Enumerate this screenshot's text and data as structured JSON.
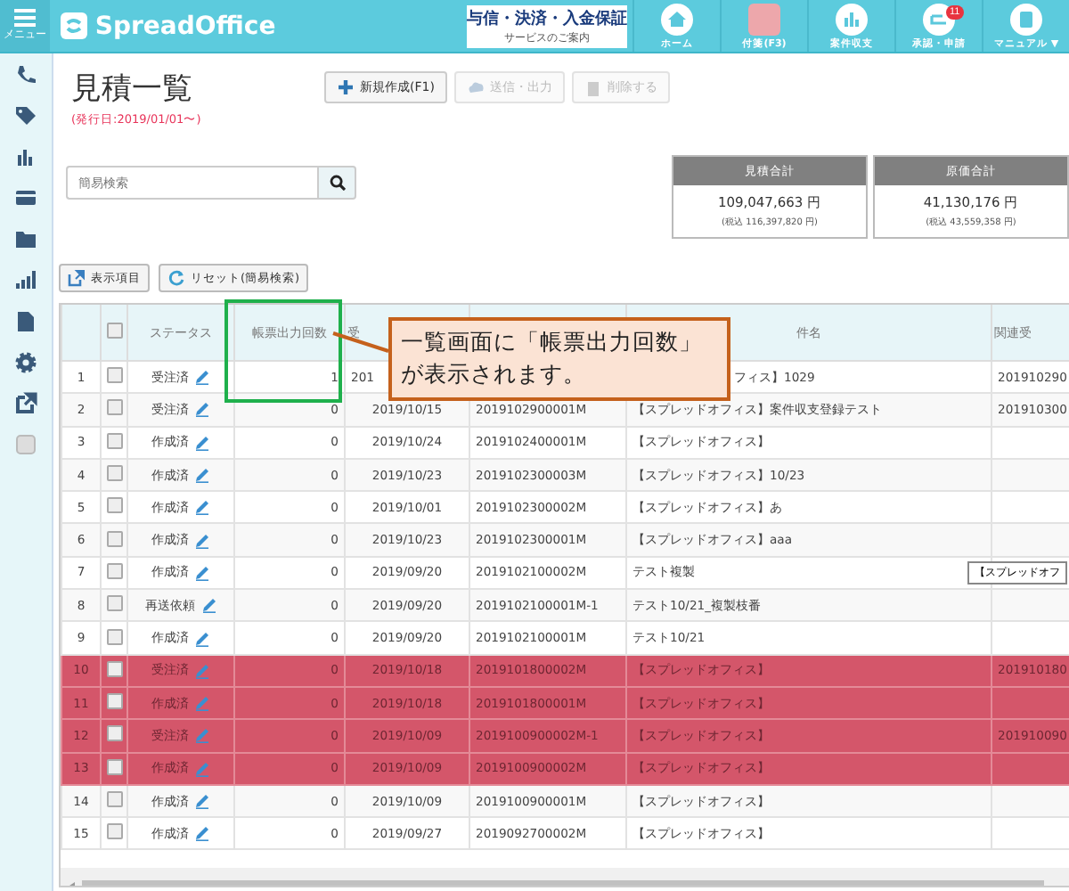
{
  "header": {
    "menu_label": "メニュー",
    "logo": "SpreadOffice",
    "banner": {
      "title": "与信・決済・入金保証",
      "subtitle": "サービスのご案内"
    },
    "nav": [
      {
        "label": "ホーム",
        "kind": "home"
      },
      {
        "label": "付箋(F3)",
        "kind": "note"
      },
      {
        "label": "案件収支",
        "kind": "chart"
      },
      {
        "label": "承認・申請",
        "kind": "approval",
        "badge": "11"
      },
      {
        "label": "マニュアル ▼",
        "kind": "manual"
      }
    ]
  },
  "sidebar": {
    "items": [
      {
        "kind": "phone"
      },
      {
        "kind": "tag"
      },
      {
        "kind": "bars"
      },
      {
        "kind": "card"
      },
      {
        "kind": "folder"
      },
      {
        "kind": "signal"
      },
      {
        "kind": "file"
      },
      {
        "kind": "gear"
      },
      {
        "kind": "external"
      },
      {
        "kind": "checkbox"
      }
    ]
  },
  "page": {
    "title": "見積一覧",
    "subtitle": "(発行日:2019/01/01〜)",
    "actions": [
      {
        "label": "新規作成(F1)",
        "kind": "plus",
        "disabled": false
      },
      {
        "label": "送信・出力",
        "kind": "cloud",
        "disabled": true
      },
      {
        "label": "削除する",
        "kind": "trash",
        "disabled": true
      }
    ],
    "search": {
      "placeholder": "簡易検索"
    },
    "totals": [
      {
        "title": "見積合計",
        "amount": "109,047,663 円",
        "tax": "(税込 116,397,820 円)"
      },
      {
        "title": "原価合計",
        "amount": "41,130,176 円",
        "tax": "(税込 43,559,358 円)"
      }
    ],
    "tools": [
      {
        "label": "表示項目",
        "kind": "external"
      },
      {
        "label": "リセット(簡易検索)",
        "kind": "reset"
      }
    ]
  },
  "table": {
    "columns": [
      {
        "kind": "index"
      },
      {
        "kind": "check",
        "checked": false
      },
      {
        "label": "ステータス",
        "kind": "status"
      },
      {
        "label": "帳票出力回数",
        "kind": "count"
      },
      {
        "label": "受",
        "kind": "date"
      },
      {
        "kind": "number"
      },
      {
        "label": "件名",
        "kind": "subject"
      },
      {
        "label": "関連受",
        "kind": "related"
      }
    ],
    "rows": [
      {
        "index": "1",
        "checked": false,
        "status": "受注済",
        "count": "1",
        "date": "201",
        "subject": "フィス】1029",
        "related": "201910290",
        "highlighted": false
      },
      {
        "index": "2",
        "checked": false,
        "status": "受注済",
        "count": "0",
        "date": "2019/10/15",
        "number": "2019102900001M",
        "subject": "【スプレッドオフィス】案件収支登録テスト",
        "related": "201910300",
        "highlighted": false
      },
      {
        "index": "3",
        "checked": false,
        "status": "作成済",
        "count": "0",
        "date": "2019/10/24",
        "number": "2019102400001M",
        "subject": "【スプレッドオフィス】",
        "highlighted": false
      },
      {
        "index": "4",
        "checked": false,
        "status": "作成済",
        "count": "0",
        "date": "2019/10/23",
        "number": "2019102300003M",
        "subject": "【スプレッドオフィス】10/23",
        "highlighted": false
      },
      {
        "index": "5",
        "checked": false,
        "status": "作成済",
        "count": "0",
        "date": "2019/10/01",
        "number": "2019102300002M",
        "subject": "【スプレッドオフィス】あ",
        "highlighted": false
      },
      {
        "index": "6",
        "checked": false,
        "status": "作成済",
        "count": "0",
        "date": "2019/10/23",
        "number": "2019102300001M",
        "subject": "【スプレッドオフィス】aaa",
        "highlighted": false
      },
      {
        "index": "7",
        "checked": false,
        "status": "作成済",
        "count": "0",
        "date": "2019/09/20",
        "number": "2019102100002M",
        "subject": "テスト複製",
        "highlighted": false
      },
      {
        "index": "8",
        "checked": false,
        "status": "再送依頼",
        "count": "0",
        "date": "2019/09/20",
        "number": "2019102100001M-1",
        "subject": "テスト10/21_複製枝番",
        "highlighted": false
      },
      {
        "index": "9",
        "checked": false,
        "status": "作成済",
        "count": "0",
        "date": "2019/09/20",
        "number": "2019102100001M",
        "subject": "テスト10/21",
        "highlighted": false
      },
      {
        "index": "10",
        "checked": false,
        "status": "受注済",
        "count": "0",
        "date": "2019/10/18",
        "number": "2019101800002M",
        "subject": "【スプレッドオフィス】",
        "related": "201910180",
        "highlighted": true
      },
      {
        "index": "11",
        "checked": false,
        "status": "作成済",
        "count": "0",
        "date": "2019/10/18",
        "number": "2019101800001M",
        "subject": "【スプレッドオフィス】",
        "highlighted": true
      },
      {
        "index": "12",
        "checked": false,
        "status": "受注済",
        "count": "0",
        "date": "2019/10/09",
        "number": "2019100900002M-1",
        "subject": "【スプレッドオフィス】",
        "related": "201910090",
        "highlighted": true
      },
      {
        "index": "13",
        "checked": false,
        "status": "作成済",
        "count": "0",
        "date": "2019/10/09",
        "number": "2019100900002M",
        "subject": "【スプレッドオフィス】",
        "highlighted": true
      },
      {
        "index": "14",
        "checked": false,
        "status": "作成済",
        "count": "0",
        "date": "2019/10/09",
        "number": "2019100900001M",
        "subject": "【スプレッドオフィス】",
        "highlighted": false
      },
      {
        "index": "15",
        "checked": false,
        "status": "作成済",
        "count": "0",
        "date": "2019/09/27",
        "number": "2019092700002M",
        "subject": "【スプレッドオフィス】",
        "highlighted": false
      }
    ],
    "tooltip": "【スプレッドオフ"
  },
  "callout": {
    "text": "一覧画面に「帳票出力回数」が表示されます。"
  }
}
